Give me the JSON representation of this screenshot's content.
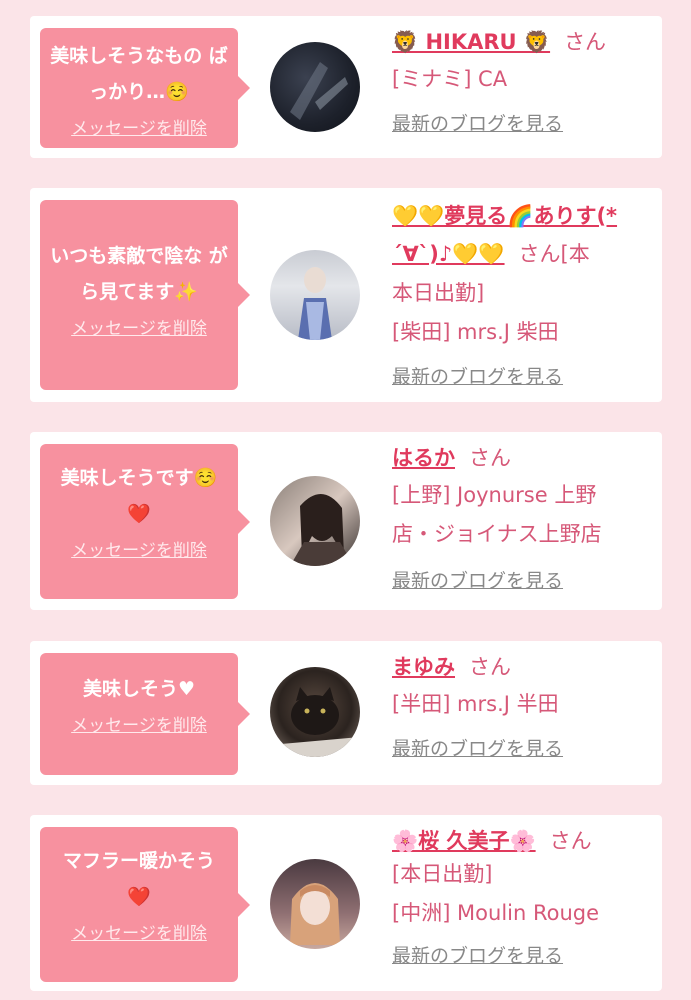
{
  "delete_label": "メッセージを削除",
  "blog_label": "最新のブログを見る",
  "san_label": "さん",
  "colors": {
    "bubble": "#f7919f",
    "name": "#e03a5d",
    "text": "#d65878",
    "link": "#888888",
    "background": "#fbe4e8"
  },
  "cards": [
    {
      "message": "美味しそうなもの ばっかり…☺️",
      "name": "🦁 HIKARU 🦁",
      "lines": [
        "[ミナミ] CA"
      ]
    },
    {
      "message": "いつも素敵で陰な がら見てます✨",
      "name": "💛💛夢見る🌈ありす(*´∀`)♪💛💛",
      "lines": [
        "本日出勤]",
        "[柴田] mrs.J 柴田"
      ],
      "san_suffix": "[本"
    },
    {
      "message": "美味しそうです☺️ ❤️",
      "name": "はるか",
      "lines": [
        "[上野] Joynurse 上野",
        "店・ジョイナス上野店"
      ]
    },
    {
      "message": "美味しそう♥",
      "name": "まゆみ",
      "lines": [
        "[半田] mrs.J 半田"
      ]
    },
    {
      "message": "マフラー暖かそう ❤️",
      "name": "🌸桜 久美子🌸",
      "lines": [
        "[本日出勤]",
        "[中洲] Moulin Rouge"
      ]
    }
  ]
}
